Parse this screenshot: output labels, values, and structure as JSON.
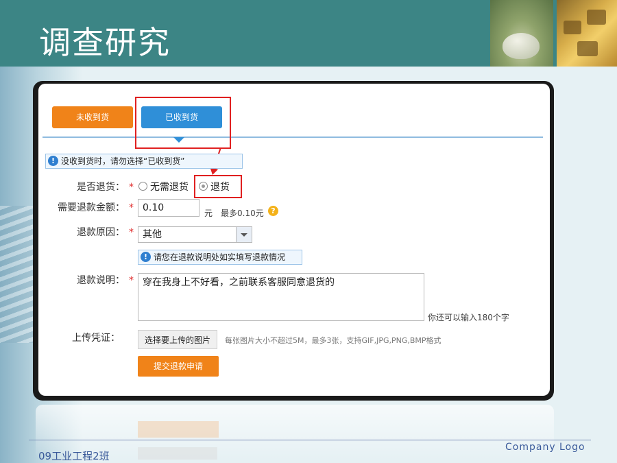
{
  "slide": {
    "title": "调查研究",
    "footer_left": "09工业工程2班",
    "footer_right": "Company Logo"
  },
  "tabs": [
    {
      "label": "未收到货"
    },
    {
      "label": "已收到货"
    }
  ],
  "form": {
    "notice_top": "没收到货时，请勿选择“已收到货”",
    "return_label": "是否退货：",
    "required_mark": "*",
    "option_no_return": "无需退货",
    "option_return": "退货",
    "amount_label": "需要退款金额：",
    "amount_value": "0.10",
    "amount_unit": "元",
    "amount_max": "最多0.10元",
    "reason_label": "退款原因：",
    "reason_selected": "其他",
    "notice_reason": "请您在退款说明处如实填写退款情况",
    "desc_label": "退款说明：",
    "desc_value": "穿在我身上不好看，之前联系客服同意退货的",
    "desc_counter": "你还可以输入180个字",
    "upload_label": "上传凭证：",
    "upload_button": "选择要上传的图片",
    "upload_hint": "每张图片大小不超过5M，最多3张，支持GIF,JPG,PNG,BMP格式",
    "submit_button": "提交退款申请"
  },
  "icons": {
    "info": "info-icon",
    "question": "question-icon",
    "dropdown": "chevron-down-icon"
  },
  "colors": {
    "header": "#3c8585",
    "orange": "#f08319",
    "blue": "#2f8fd8",
    "highlight": "#e02020"
  }
}
